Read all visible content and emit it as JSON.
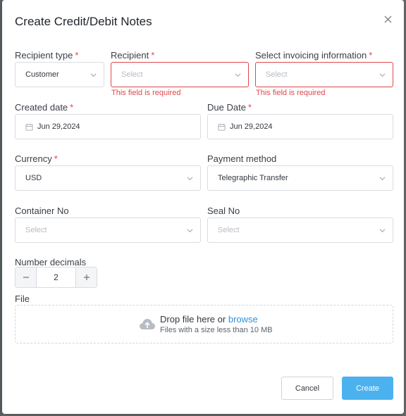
{
  "modal": {
    "title": "Create Credit/Debit Notes"
  },
  "fields": {
    "recipient_type": {
      "label": "Recipient type",
      "required": "*",
      "value": "Customer"
    },
    "recipient": {
      "label": "Recipient",
      "required": "*",
      "placeholder": "Select",
      "error": "This field is required"
    },
    "invoicing_info": {
      "label": "Select invoicing information",
      "required": "*",
      "placeholder": "Select",
      "error": "This field is required"
    },
    "created_date": {
      "label": "Created date",
      "required": "*",
      "value": "Jun 29,2024"
    },
    "due_date": {
      "label": "Due Date",
      "required": "*",
      "value": "Jun 29,2024"
    },
    "currency": {
      "label": "Currency",
      "required": "*",
      "value": "USD"
    },
    "payment_method": {
      "label": "Payment method",
      "value": "Telegraphic Transfer"
    },
    "container_no": {
      "label": "Container No",
      "placeholder": "Select"
    },
    "seal_no": {
      "label": "Seal No",
      "placeholder": "Select"
    },
    "number_decimals": {
      "label": "Number decimals",
      "value": "2"
    },
    "file": {
      "label": "File",
      "drop_text": "Drop file here or",
      "browse_text": "browse",
      "hint": "Files with a size less than 10 MB"
    }
  },
  "footer": {
    "cancel_label": "Cancel",
    "create_label": "Create"
  },
  "colors": {
    "accent": "#4cb2ef",
    "error": "#e0474c",
    "link": "#2f8fde"
  }
}
